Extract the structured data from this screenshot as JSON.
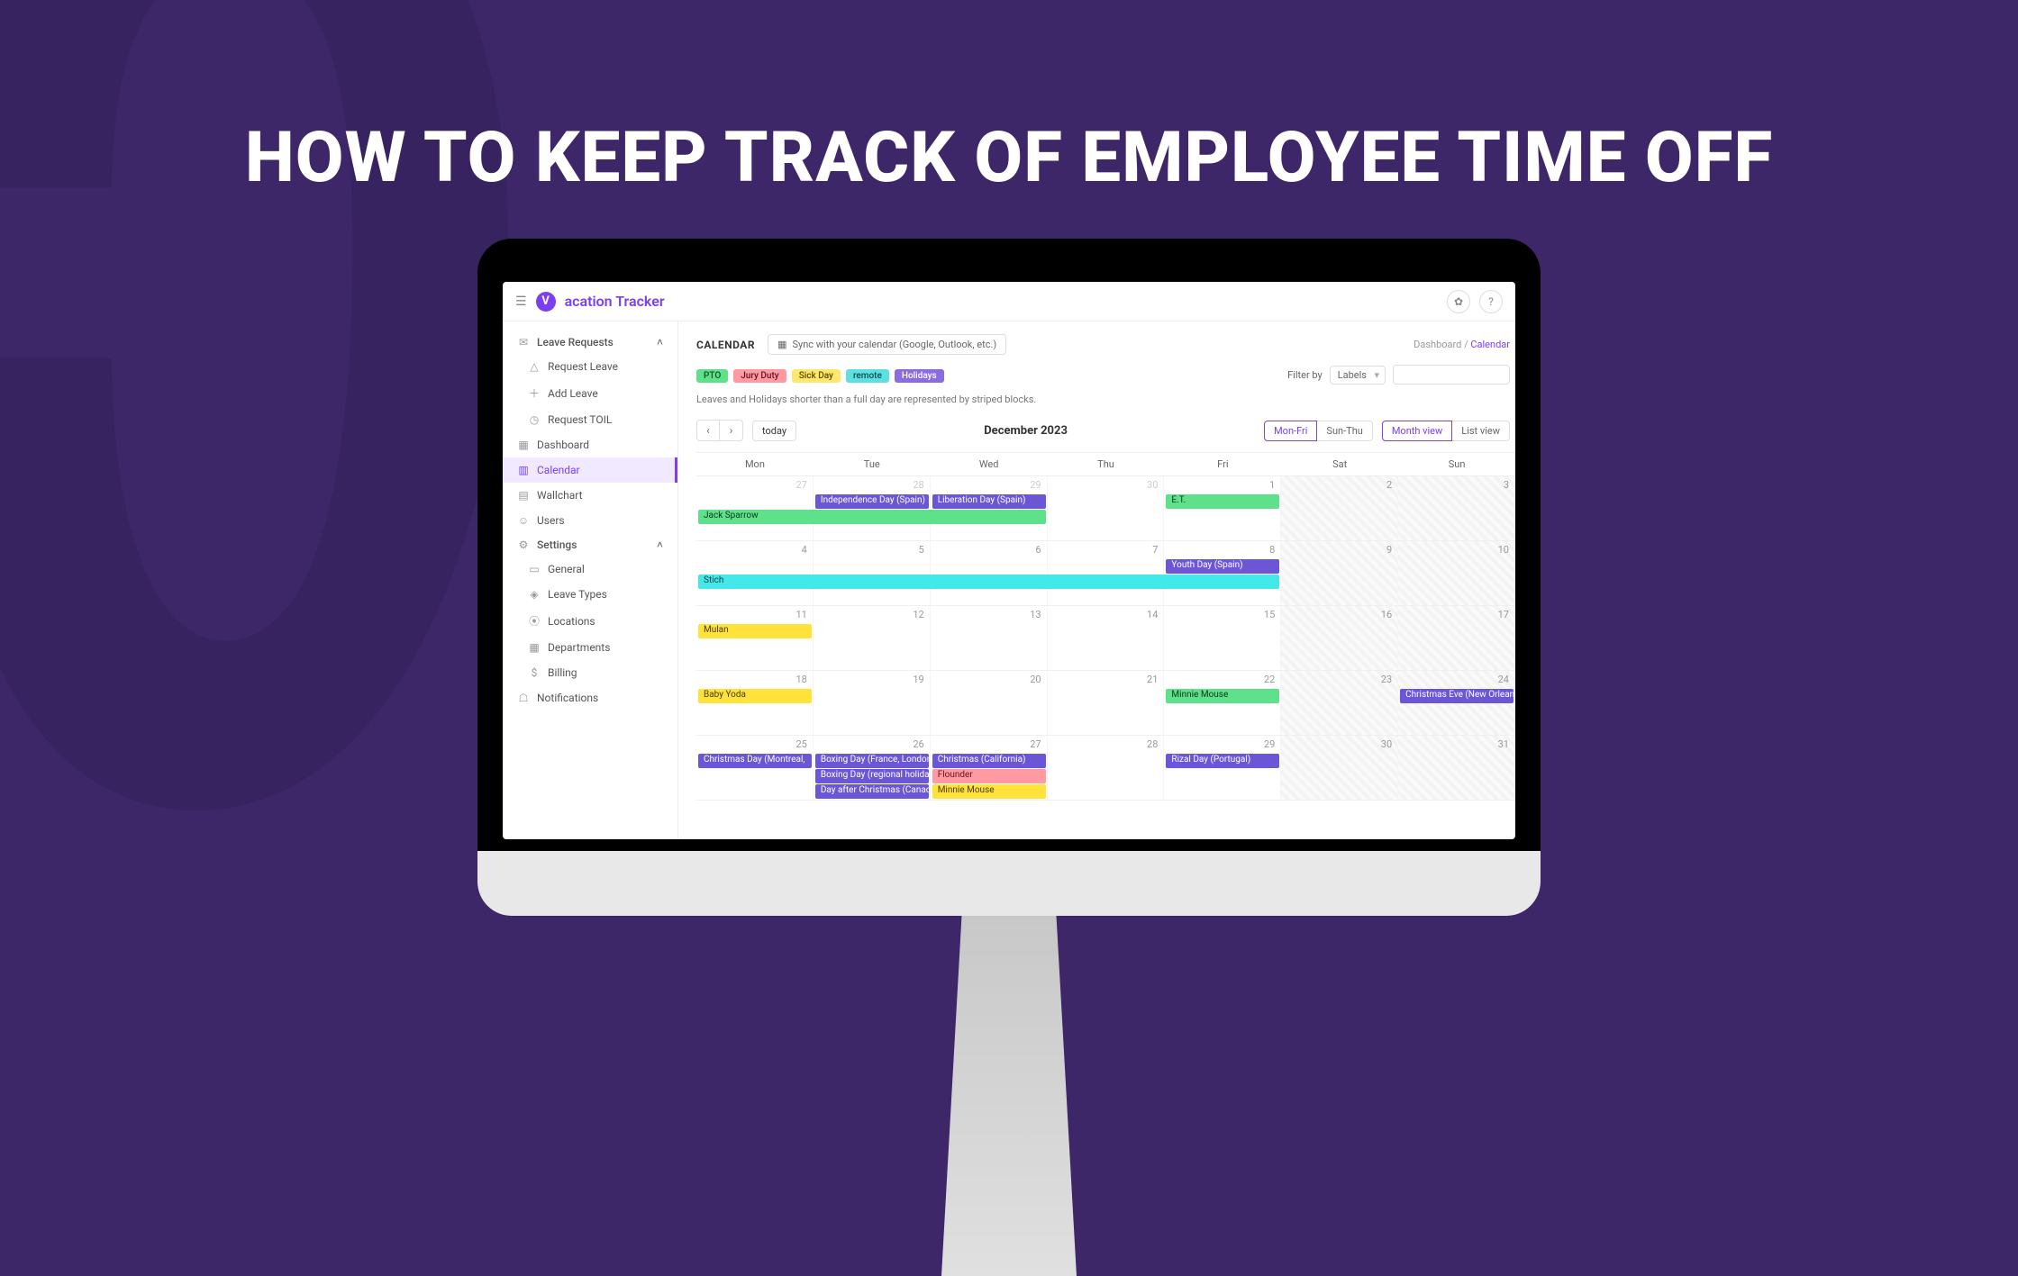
{
  "hero": "HOW TO KEEP TRACK OF EMPLOYEE TIME OFF",
  "brand": "acation Tracker",
  "sidebar": {
    "leaveRequests": "Leave Requests",
    "requestLeave": "Request Leave",
    "addLeave": "Add Leave",
    "requestToil": "Request TOIL",
    "dashboard": "Dashboard",
    "calendar": "Calendar",
    "wallchart": "Wallchart",
    "users": "Users",
    "settings": "Settings",
    "general": "General",
    "leaveTypes": "Leave Types",
    "locations": "Locations",
    "departments": "Departments",
    "billing": "Billing",
    "notifications": "Notifications"
  },
  "header": {
    "title": "CALENDAR",
    "sync": "Sync with your calendar (Google, Outlook, etc.)",
    "crumbs1": "Dashboard",
    "crumbs2": "Calendar"
  },
  "legend": {
    "pto": "PTO",
    "jury": "Jury Duty",
    "sick": "Sick Day",
    "remote": "remote",
    "hol": "Holidays"
  },
  "filter": {
    "label": "Filter by",
    "labels": "Labels"
  },
  "note": "Leaves and Holidays shorter than a full day are represented by striped blocks.",
  "toolbar": {
    "today": "today",
    "month": "December 2023",
    "monfri": "Mon-Fri",
    "sunthu": "Sun-Thu",
    "monthview": "Month view",
    "listview": "List view"
  },
  "dow": [
    "Mon",
    "Tue",
    "Wed",
    "Thu",
    "Fri",
    "Sat",
    "Sun"
  ],
  "weeks": [
    {
      "days": [
        {
          "n": "27",
          "o": true
        },
        {
          "n": "28",
          "o": true
        },
        {
          "n": "29",
          "o": true
        },
        {
          "n": "30",
          "o": true
        },
        {
          "n": "1"
        },
        {
          "n": "2",
          "w": true
        },
        {
          "n": "3",
          "w": true
        }
      ]
    },
    {
      "days": [
        {
          "n": "4"
        },
        {
          "n": "5"
        },
        {
          "n": "6"
        },
        {
          "n": "7"
        },
        {
          "n": "8"
        },
        {
          "n": "9",
          "w": true
        },
        {
          "n": "10",
          "w": true
        }
      ]
    },
    {
      "days": [
        {
          "n": "11"
        },
        {
          "n": "12"
        },
        {
          "n": "13"
        },
        {
          "n": "14"
        },
        {
          "n": "15"
        },
        {
          "n": "16",
          "w": true
        },
        {
          "n": "17",
          "w": true
        }
      ]
    },
    {
      "days": [
        {
          "n": "18"
        },
        {
          "n": "19"
        },
        {
          "n": "20"
        },
        {
          "n": "21"
        },
        {
          "n": "22"
        },
        {
          "n": "23",
          "w": true
        },
        {
          "n": "24",
          "w": true
        }
      ]
    },
    {
      "days": [
        {
          "n": "25"
        },
        {
          "n": "26"
        },
        {
          "n": "27"
        },
        {
          "n": "28"
        },
        {
          "n": "29"
        },
        {
          "n": "30",
          "w": true
        },
        {
          "n": "31",
          "w": true
        }
      ]
    }
  ],
  "events": {
    "w0": [
      {
        "t": "Independence Day (Spain)",
        "c": "ev-purple",
        "s": 1,
        "e": 2,
        "r": 0
      },
      {
        "t": "Liberation Day (Spain)",
        "c": "ev-purple",
        "s": 2,
        "e": 3,
        "r": 0
      },
      {
        "t": "E.T.",
        "c": "ev-green",
        "s": 4,
        "e": 5,
        "r": 0
      },
      {
        "t": "Jack Sparrow",
        "c": "ev-green",
        "s": 0,
        "e": 3,
        "r": 1
      }
    ],
    "w1": [
      {
        "t": "Youth Day (Spain)",
        "c": "ev-purple",
        "s": 4,
        "e": 5,
        "r": 0
      },
      {
        "t": "Stich",
        "c": "ev-cyan",
        "s": 0,
        "e": 5,
        "r": 1
      }
    ],
    "w2": [
      {
        "t": "Mulan",
        "c": "ev-yellow",
        "s": 0,
        "e": 1,
        "r": 0
      }
    ],
    "w3": [
      {
        "t": "Baby Yoda",
        "c": "ev-yellow",
        "s": 0,
        "e": 1,
        "r": 0
      },
      {
        "t": "Minnie Mouse",
        "c": "ev-green",
        "s": 4,
        "e": 5,
        "r": 0
      },
      {
        "t": "Christmas Eve (New Orleans)",
        "c": "ev-purple",
        "s": 6,
        "e": 7,
        "r": 0
      }
    ],
    "w4": [
      {
        "t": "Christmas Day (Montreal,",
        "c": "ev-purple",
        "s": 0,
        "e": 1,
        "r": 0
      },
      {
        "t": "Boxing Day (France, London)",
        "c": "ev-purple",
        "s": 1,
        "e": 2,
        "r": 0
      },
      {
        "t": "Christmas (California)",
        "c": "ev-purple",
        "s": 2,
        "e": 3,
        "r": 0
      },
      {
        "t": "Rizal Day (Portugal)",
        "c": "ev-purple",
        "s": 4,
        "e": 5,
        "r": 0
      },
      {
        "t": "Boxing Day (regional holiday)",
        "c": "ev-purple",
        "s": 1,
        "e": 2,
        "r": 1
      },
      {
        "t": "Flounder",
        "c": "ev-pink",
        "s": 2,
        "e": 3,
        "r": 1
      },
      {
        "t": "Day after Christmas (Canada)",
        "c": "ev-purple",
        "s": 1,
        "e": 2,
        "r": 2
      },
      {
        "t": "Minnie Mouse",
        "c": "ev-yellow",
        "s": 2,
        "e": 3,
        "r": 2
      }
    ]
  }
}
